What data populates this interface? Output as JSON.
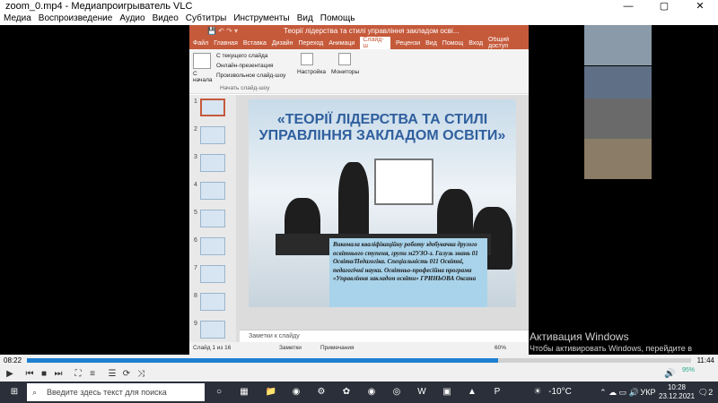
{
  "vlc": {
    "title": "zoom_0.mp4 - Медиапроигрыватель VLC",
    "menu": [
      "Медиа",
      "Воспроизведение",
      "Аудио",
      "Видео",
      "Субтитры",
      "Инструменты",
      "Вид",
      "Помощь"
    ],
    "time_current": "08:22",
    "time_total": "11:44",
    "progress": 0.71,
    "volume": "95%"
  },
  "ppt": {
    "window_title": "Теорії лідерства та стилі управління закладом осві...",
    "tabs": [
      "Файл",
      "Главная",
      "Вставка",
      "Дизайн",
      "Переход",
      "Анимаци",
      "Слайд-ш",
      "Рецензи",
      "Вид",
      "Помощ",
      "Вход",
      "Общий доступ"
    ],
    "active_tab": "Слайд-ш",
    "ribbon": {
      "from_start": "С начала",
      "from_current": "С текущего слайда",
      "online": "Онлайн-презентация",
      "custom": "Произвольное слайд-шоу",
      "group_label": "Начать слайд-шоу",
      "setup": "Настройка",
      "monitors": "Мониторы"
    },
    "thumbnail_numbers": [
      "1",
      "2",
      "3",
      "4",
      "5",
      "6",
      "7",
      "8",
      "9"
    ],
    "slide": {
      "title": "«ТЕОРІЇ ЛІДЕРСТВА ТА СТИЛІ УПРАВЛІННЯ ЗАКЛАДОМ ОСВІТИ»",
      "body": "Виконала кваліфікаційну роботу здобувачка другого освітнього ступеня, групи м2УЗО-з. Галузь знань 01 Освіта/Педагогіка. Спеціальність 011 Освітні, педагогічні науки. Освітньо-професійна програма «Управління закладом освіти» ГРИНЬОВА Оксана"
    },
    "notes_placeholder": "Заметки к слайду",
    "status": {
      "slide_count": "Слайд 1 из 16",
      "notes": "Заметки",
      "comments": "Примечания",
      "zoom": "60%"
    }
  },
  "watermark": {
    "line1": "Активация Windows",
    "line2": "Чтобы активировать Windows, перейдите в"
  },
  "taskbar": {
    "search_placeholder": "Введите здесь текст для поиска",
    "temperature": "-10°C",
    "lang": "УКР",
    "time": "10:28",
    "date": "23.12.2021",
    "notif": "2"
  }
}
